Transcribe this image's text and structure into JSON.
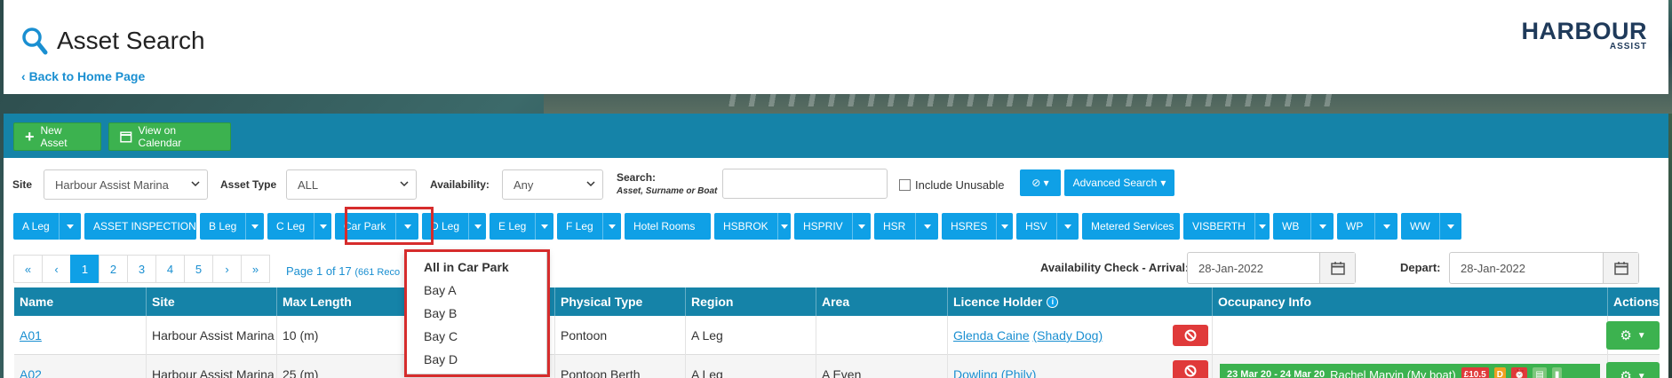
{
  "page": {
    "title": "Asset Search",
    "back_link": "Back to Home Page",
    "logo_main": "HARBOUR",
    "logo_sub": "ASSIST"
  },
  "toolbar": {
    "new_asset": "New Asset",
    "view_calendar": "View on Calendar"
  },
  "filters": {
    "site_label": "Site",
    "site_value": "Harbour Assist Marina",
    "asset_type_label": "Asset Type",
    "asset_type_value": "ALL",
    "availability_label": "Availability:",
    "availability_value": "Any",
    "search_label": "Search:",
    "search_hint": "Asset, Surname or Boat",
    "search_value": "",
    "include_unusable": "Include Unusable",
    "advanced_search": "Advanced Search"
  },
  "filter_buttons": [
    {
      "label": "A Leg",
      "dropdown": true
    },
    {
      "label": "ASSET INSPECTIONS",
      "dropdown": false
    },
    {
      "label": "B Leg",
      "dropdown": true
    },
    {
      "label": "C Leg",
      "dropdown": true
    },
    {
      "label": "Car Park",
      "dropdown": true
    },
    {
      "label": "D Leg",
      "dropdown": true
    },
    {
      "label": "E Leg",
      "dropdown": true
    },
    {
      "label": "F Leg",
      "dropdown": true
    },
    {
      "label": "Hotel Rooms",
      "dropdown": false
    },
    {
      "label": "HSBROK",
      "dropdown": true
    },
    {
      "label": "HSPRIV",
      "dropdown": true
    },
    {
      "label": "HSR",
      "dropdown": true
    },
    {
      "label": "HSRES",
      "dropdown": true
    },
    {
      "label": "HSV",
      "dropdown": true
    },
    {
      "label": "Metered Services",
      "dropdown": false
    },
    {
      "label": "VISBERTH",
      "dropdown": true
    },
    {
      "label": "WB",
      "dropdown": true
    },
    {
      "label": "WP",
      "dropdown": true
    },
    {
      "label": "WW",
      "dropdown": true
    }
  ],
  "car_park_menu": {
    "items": [
      "All in Car Park",
      "Bay A",
      "Bay B",
      "Bay C",
      "Bay D"
    ]
  },
  "pagination": {
    "first": "«",
    "prev": "‹",
    "pages": [
      "1",
      "2",
      "3",
      "4",
      "5"
    ],
    "next": "›",
    "last": "»",
    "info": "Page 1 of 17",
    "info_count": "(661 Reco"
  },
  "availability_check": {
    "arrival_label": "Availability Check - Arrival:",
    "arrival_value": "28-Jan-2022",
    "depart_label": "Depart:",
    "depart_value": "28-Jan-2022"
  },
  "table": {
    "headers": [
      "Name",
      "Site",
      "Max Length",
      "Physical Type",
      "Region",
      "Area",
      "Licence Holder",
      "Occupancy Info",
      "Actions"
    ],
    "rows": [
      {
        "name": "A01",
        "site": "Harbour Assist Marina",
        "max_length": "10 (m)",
        "physical_type": "Pontoon",
        "region": "A Leg",
        "area": "",
        "holder": "Glenda Caine",
        "boat": "(Shady Dog)"
      },
      {
        "name": "A02",
        "site": "Harbour Assist Marina",
        "max_length": "25 (m)",
        "physical_type": "Pontoon Berth",
        "region": "A Leg",
        "area": "A Even",
        "holder": "Dowling",
        "boat": "(Phily)",
        "occupancy": {
          "dates": "23 Mar 20 - 24 Mar 20",
          "name": "Rachel Marvin (My boat)",
          "amount": "£10.5",
          "badge": "D"
        }
      }
    ]
  },
  "colors": {
    "primary": "#0fa0e6",
    "band": "#1583a8",
    "green": "#3cb24f",
    "red": "#e03a3a",
    "highlight": "#d62c2c"
  }
}
